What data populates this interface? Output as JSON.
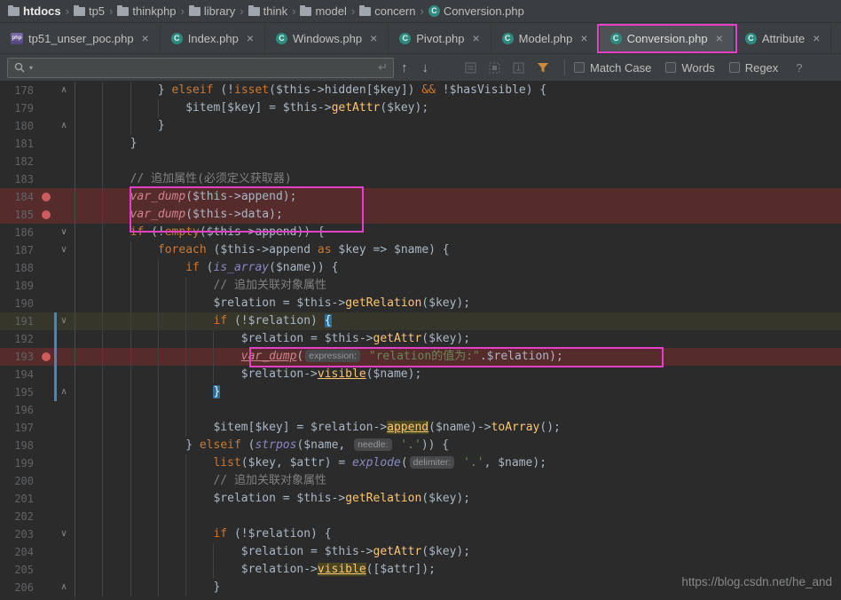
{
  "breadcrumb": {
    "separator": "›",
    "items": [
      {
        "label": "htdocs",
        "icon": "folder",
        "bold": true
      },
      {
        "label": "tp5",
        "icon": "folder"
      },
      {
        "label": "thinkphp",
        "icon": "folder"
      },
      {
        "label": "library",
        "icon": "folder"
      },
      {
        "label": "think",
        "icon": "folder"
      },
      {
        "label": "model",
        "icon": "folder"
      },
      {
        "label": "concern",
        "icon": "folder"
      },
      {
        "label": "Conversion.php",
        "icon": "php-class"
      }
    ]
  },
  "tabs": {
    "close_glyph": "×",
    "items": [
      {
        "label": "tp51_unser_poc.php",
        "icon": "php-file",
        "active": false
      },
      {
        "label": "Index.php",
        "icon": "php-class",
        "active": false
      },
      {
        "label": "Windows.php",
        "icon": "php-class",
        "active": false
      },
      {
        "label": "Pivot.php",
        "icon": "php-class",
        "active": false
      },
      {
        "label": "Model.php",
        "icon": "php-class",
        "active": false
      },
      {
        "label": "Conversion.php",
        "icon": "php-class",
        "active": true
      },
      {
        "label": "Attribute",
        "icon": "php-class",
        "active": false
      }
    ]
  },
  "search": {
    "value": "",
    "return_glyph": "↵",
    "up_glyph": "↑",
    "down_glyph": "↓",
    "options": [
      "Match Case",
      "Words",
      "Regex"
    ],
    "help": "?"
  },
  "editor": {
    "lines": [
      {
        "num": "178",
        "fold": "up",
        "seg": [
          [
            "t",
            "            } "
          ],
          [
            "k",
            "elseif"
          ],
          [
            "t",
            " (!"
          ],
          [
            "k",
            "isset"
          ],
          [
            "t",
            "($this->hidden[$key]) "
          ],
          [
            "k",
            "&&"
          ],
          [
            "t",
            " !$hasVisible) {"
          ]
        ]
      },
      {
        "num": "179",
        "seg": [
          [
            "t",
            "                $item[$key] = $this->"
          ],
          [
            "m",
            "getAttr"
          ],
          [
            "t",
            "($key);"
          ]
        ]
      },
      {
        "num": "180",
        "fold": "up",
        "seg": [
          [
            "t",
            "            }"
          ]
        ]
      },
      {
        "num": "181",
        "seg": [
          [
            "t",
            "        }"
          ]
        ]
      },
      {
        "num": "182",
        "seg": [
          [
            "t",
            "        "
          ]
        ]
      },
      {
        "num": "183",
        "seg": [
          [
            "t",
            "        "
          ],
          [
            "c",
            "// 追加属性(必须定义获取器)"
          ]
        ]
      },
      {
        "num": "184",
        "bp": true,
        "row": "bp",
        "seg": [
          [
            "t",
            "        "
          ],
          [
            "d",
            "var_dump"
          ],
          [
            "t",
            "($this->append);"
          ]
        ]
      },
      {
        "num": "185",
        "bp": true,
        "row": "bp",
        "seg": [
          [
            "t",
            "        "
          ],
          [
            "d",
            "var_dump"
          ],
          [
            "t",
            "($this->data);"
          ]
        ]
      },
      {
        "num": "186",
        "fold": "down",
        "seg": [
          [
            "t",
            "        "
          ],
          [
            "k",
            "if"
          ],
          [
            "t",
            " (!"
          ],
          [
            "k",
            "empty"
          ],
          [
            "t",
            "($this->append)) {"
          ]
        ]
      },
      {
        "num": "187",
        "fold": "down",
        "seg": [
          [
            "t",
            "            "
          ],
          [
            "k",
            "foreach"
          ],
          [
            "t",
            " ($this->append "
          ],
          [
            "k",
            "as"
          ],
          [
            "t",
            " $key => $name) {"
          ]
        ]
      },
      {
        "num": "188",
        "seg": [
          [
            "t",
            "                "
          ],
          [
            "k",
            "if"
          ],
          [
            "t",
            " ("
          ],
          [
            "p",
            "is_array"
          ],
          [
            "t",
            "($name)) {"
          ]
        ]
      },
      {
        "num": "189",
        "seg": [
          [
            "t",
            "                    "
          ],
          [
            "c",
            "// 追加关联对象属性"
          ]
        ]
      },
      {
        "num": "190",
        "seg": [
          [
            "t",
            "                    $relation = $this->"
          ],
          [
            "m",
            "getRelation"
          ],
          [
            "t",
            "($key);"
          ]
        ]
      },
      {
        "num": "191",
        "fold": "down",
        "row": "cur",
        "seg": [
          [
            "t",
            "                    "
          ],
          [
            "k",
            "if"
          ],
          [
            "t",
            " (!$relation) "
          ],
          [
            "b",
            "{"
          ]
        ]
      },
      {
        "num": "192",
        "seg": [
          [
            "t",
            "                        $relation = $this->"
          ],
          [
            "m",
            "getAttr"
          ],
          [
            "t",
            "($key);"
          ]
        ]
      },
      {
        "num": "193",
        "bp": true,
        "row": "bp",
        "seg": [
          [
            "t",
            "                        "
          ],
          [
            "du",
            "var_dump"
          ],
          [
            "t",
            "("
          ],
          [
            "h",
            "expression:"
          ],
          [
            "t",
            " "
          ],
          [
            "s",
            "\"relation的值为:\""
          ],
          [
            "t",
            ".$relation);"
          ]
        ]
      },
      {
        "num": "194",
        "seg": [
          [
            "t",
            "                        $relation->"
          ],
          [
            "un",
            "visible"
          ],
          [
            "t",
            "($name);"
          ]
        ]
      },
      {
        "num": "195",
        "fold": "up",
        "seg": [
          [
            "t",
            "                    "
          ],
          [
            "b",
            "}"
          ]
        ]
      },
      {
        "num": "196",
        "seg": [
          [
            "t",
            "                    "
          ]
        ]
      },
      {
        "num": "197",
        "seg": [
          [
            "t",
            "                    $item[$key] = $relation->"
          ],
          [
            "oc",
            "append"
          ],
          [
            "t",
            "($name)->"
          ],
          [
            "m",
            "toArray"
          ],
          [
            "t",
            "();"
          ]
        ]
      },
      {
        "num": "198",
        "seg": [
          [
            "t",
            "                } "
          ],
          [
            "k",
            "elseif"
          ],
          [
            "t",
            " ("
          ],
          [
            "p",
            "strpos"
          ],
          [
            "t",
            "($name, "
          ],
          [
            "h",
            "needle:"
          ],
          [
            "t",
            " "
          ],
          [
            "s",
            "'.'"
          ],
          [
            "t",
            ")) {"
          ]
        ]
      },
      {
        "num": "199",
        "seg": [
          [
            "t",
            "                    "
          ],
          [
            "k",
            "list"
          ],
          [
            "t",
            "($key, $attr) = "
          ],
          [
            "p",
            "explode"
          ],
          [
            "t",
            "("
          ],
          [
            "h",
            "delimiter:"
          ],
          [
            "t",
            " "
          ],
          [
            "s",
            "'.'"
          ],
          [
            "t",
            ", $name);"
          ]
        ]
      },
      {
        "num": "200",
        "seg": [
          [
            "t",
            "                    "
          ],
          [
            "c",
            "// 追加关联对象属性"
          ]
        ]
      },
      {
        "num": "201",
        "seg": [
          [
            "t",
            "                    $relation = $this->"
          ],
          [
            "m",
            "getRelation"
          ],
          [
            "t",
            "($key);"
          ]
        ]
      },
      {
        "num": "202",
        "seg": [
          [
            "t",
            "                    "
          ]
        ]
      },
      {
        "num": "203",
        "fold": "down",
        "seg": [
          [
            "t",
            "                    "
          ],
          [
            "k",
            "if"
          ],
          [
            "t",
            " (!$relation) {"
          ]
        ]
      },
      {
        "num": "204",
        "seg": [
          [
            "t",
            "                        $relation = $this->"
          ],
          [
            "m",
            "getAttr"
          ],
          [
            "t",
            "($key);"
          ]
        ]
      },
      {
        "num": "205",
        "seg": [
          [
            "t",
            "                        $relation->"
          ],
          [
            "oc",
            "visible"
          ],
          [
            "t",
            "([$attr]);"
          ]
        ]
      },
      {
        "num": "206",
        "fold": "up",
        "seg": [
          [
            "t",
            "                    }"
          ]
        ]
      }
    ]
  },
  "watermark": "https://blog.csdn.net/he_and",
  "colors": {
    "annotation": "#E33FC7",
    "editor_background": "#2B2B2B",
    "breakpoint_line": "#552B2B",
    "breakpoint_dot": "#CD5C5C",
    "keyword": "#CC7832",
    "method": "#FFC66D",
    "string": "#6A8759",
    "comment": "#808080"
  }
}
